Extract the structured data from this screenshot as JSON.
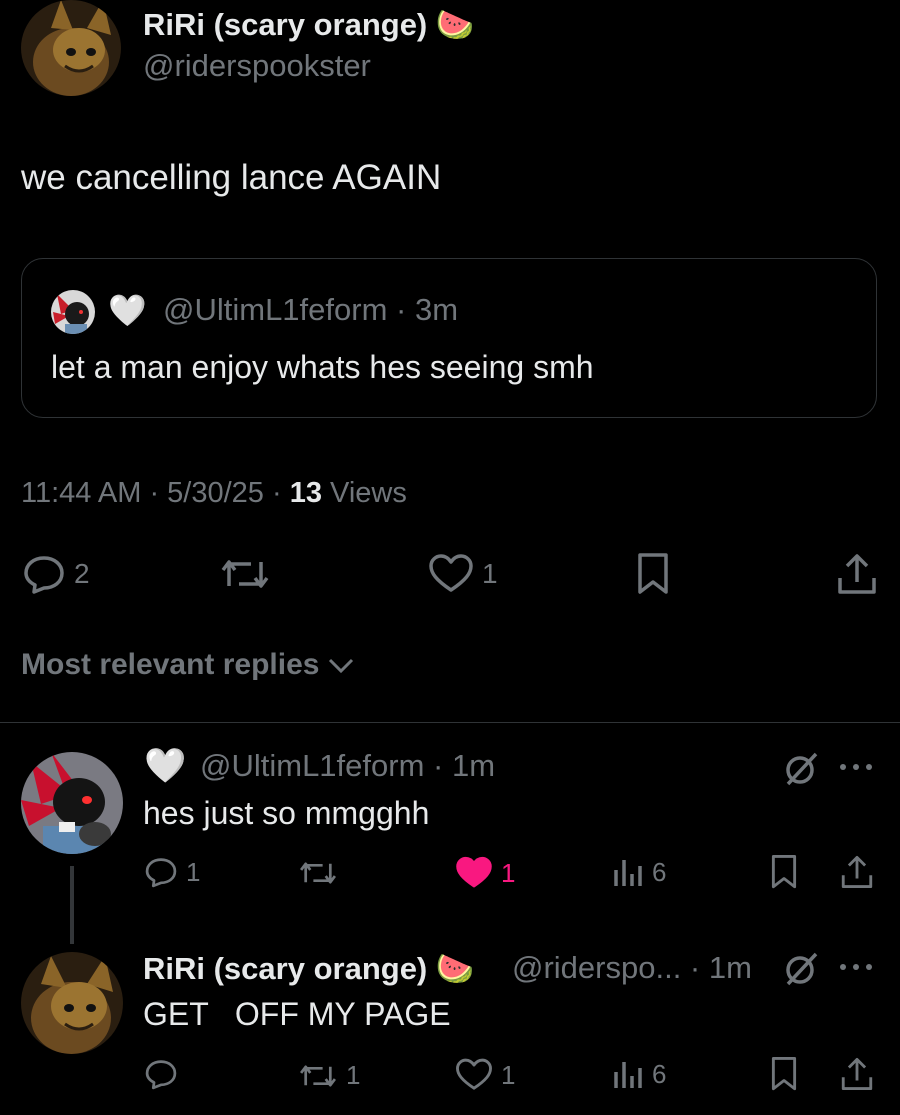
{
  "main_tweet": {
    "author_name": "RiRi (scary orange)",
    "author_emoji": "🍉",
    "handle": "@riderspookster",
    "text": "we cancelling lance AGAIN",
    "quote": {
      "emoji": "🤍",
      "handle": "@UltimL1feform",
      "time": "3m",
      "text": "let a man enjoy whats hes seeing smh"
    },
    "time": "11:44 AM",
    "date": "5/30/25",
    "views_count": "13",
    "views_label": "Views",
    "actions": {
      "reply_count": "2",
      "like_count": "1"
    }
  },
  "replies_sort": {
    "label": "Most relevant replies"
  },
  "replies": [
    {
      "emoji": "🤍",
      "handle": "@UltimL1feform",
      "time": "1m",
      "text": "hes just so mmgghh",
      "reply_count": "1",
      "like_count": "1",
      "views": "6",
      "like_color": "#f91880"
    },
    {
      "author_name": "RiRi (scary orange)",
      "author_emoji": "🍉",
      "handle": "@riderspo...",
      "time": "1m",
      "text": "GET   OFF MY PAGE",
      "retweet_count": "1",
      "like_count": "1",
      "views": "6"
    }
  ]
}
